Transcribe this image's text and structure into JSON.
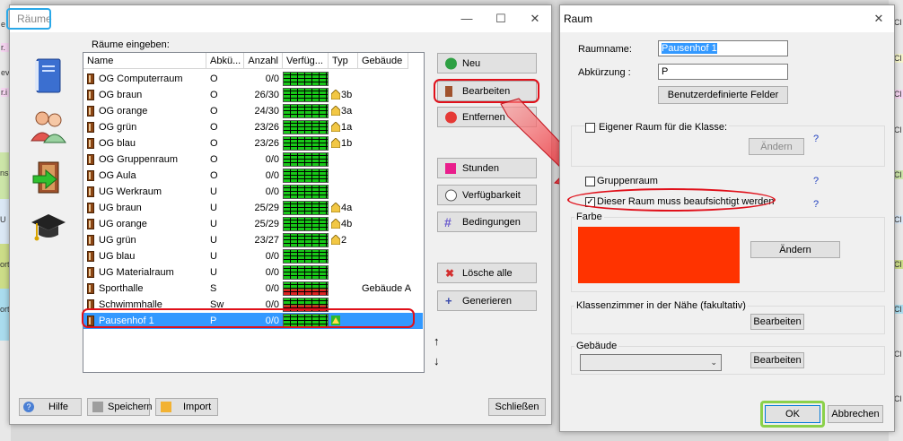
{
  "background": {
    "left_cells": [
      "e",
      "r.",
      "ev",
      "r.i",
      "nsi",
      "U",
      "ort",
      "ort"
    ],
    "right_cells": [
      "Cl",
      "Cl",
      "Cl",
      "Cl",
      "Cl",
      "Cl",
      "Cl",
      "Cl",
      "Cl",
      "Cl"
    ]
  },
  "raeume_window": {
    "title": "Räume",
    "list_label": "Räume eingeben:",
    "columns": [
      "Name",
      "Abkü...",
      "Anzahl",
      "Verfüg...",
      "Typ",
      "Gebäude"
    ],
    "rows": [
      {
        "name": "OG Computerraum",
        "abk": "O",
        "anzahl": "0/0",
        "typ": "",
        "gebaeude": "",
        "avail": "green"
      },
      {
        "name": "OG braun",
        "abk": "O",
        "anzahl": "26/30",
        "typ": "3b",
        "gebaeude": "",
        "avail": "green"
      },
      {
        "name": "OG orange",
        "abk": "O",
        "anzahl": "24/30",
        "typ": "3a",
        "gebaeude": "",
        "avail": "green"
      },
      {
        "name": "OG grün",
        "abk": "O",
        "anzahl": "23/26",
        "typ": "1a",
        "gebaeude": "",
        "avail": "green"
      },
      {
        "name": "OG blau",
        "abk": "O",
        "anzahl": "23/26",
        "typ": "1b",
        "gebaeude": "",
        "avail": "green"
      },
      {
        "name": "OG Gruppenraum",
        "abk": "O",
        "anzahl": "0/0",
        "typ": "",
        "gebaeude": "",
        "avail": "green"
      },
      {
        "name": "OG Aula",
        "abk": "O",
        "anzahl": "0/0",
        "typ": "",
        "gebaeude": "",
        "avail": "green"
      },
      {
        "name": "UG Werkraum",
        "abk": "U",
        "anzahl": "0/0",
        "typ": "",
        "gebaeude": "",
        "avail": "green"
      },
      {
        "name": "UG braun",
        "abk": "U",
        "anzahl": "25/29",
        "typ": "4a",
        "gebaeude": "",
        "avail": "green"
      },
      {
        "name": "UG orange",
        "abk": "U",
        "anzahl": "25/29",
        "typ": "4b",
        "gebaeude": "",
        "avail": "green"
      },
      {
        "name": "UG grün",
        "abk": "U",
        "anzahl": "23/27",
        "typ": "2",
        "gebaeude": "",
        "avail": "green"
      },
      {
        "name": "UG blau",
        "abk": "U",
        "anzahl": "0/0",
        "typ": "",
        "gebaeude": "",
        "avail": "green"
      },
      {
        "name": "UG Materialraum",
        "abk": "U",
        "anzahl": "0/0",
        "typ": "",
        "gebaeude": "",
        "avail": "green"
      },
      {
        "name": "Sporthalle",
        "abk": "S",
        "anzahl": "0/0",
        "typ": "",
        "gebaeude": "Gebäude A",
        "avail": "red"
      },
      {
        "name": "Schwimmhalle",
        "abk": "Sw",
        "anzahl": "0/0",
        "typ": "",
        "gebaeude": "",
        "avail": "red"
      },
      {
        "name": "Pausenhof 1",
        "abk": "P",
        "anzahl": "0/0",
        "typ": "",
        "gebaeude": "",
        "avail": "green",
        "selected": true
      }
    ],
    "buttons": {
      "neu": "Neu",
      "bearbeiten": "Bearbeiten",
      "entfernen": "Entfernen",
      "stunden": "Stunden",
      "verfuegbarkeit": "Verfügbarkeit",
      "bedingungen": "Bedingungen",
      "loesche_alle": "Lösche alle",
      "generieren": "Generieren",
      "hilfe": "Hilfe",
      "speichern": "Speichern",
      "import": "Import",
      "schliessen": "Schließen"
    },
    "arrows": {
      "up": "↑",
      "down": "↓"
    }
  },
  "raum_dialog": {
    "title": "Raum",
    "raumname_label": "Raumname:",
    "raumname_value": "Pausenhof 1",
    "abkuerzung_label": "Abkürzung :",
    "abkuerzung_value": "P",
    "benutzer_felder": "Benutzerdefinierte Felder",
    "eigener_raum_label": "Eigener Raum für die Klasse:",
    "aendern": "Ändern",
    "gruppenraum_label": "Gruppenraum",
    "beaufsichtigt_label": "Dieser Raum muss beaufsichtigt werden",
    "farbe_label": "Farbe",
    "farbe_value": "#ff3300",
    "farbe_aendern": "Ändern",
    "klassenzimmer_label": "Klassenzimmer in der Nähe (fakultativ)",
    "bearbeiten": "Bearbeiten",
    "gebaeude_label": "Gebäude",
    "gebaeude_bearbeiten": "Bearbeiten",
    "ok": "OK",
    "abbrechen": "Abbrechen",
    "help_mark": "?"
  }
}
